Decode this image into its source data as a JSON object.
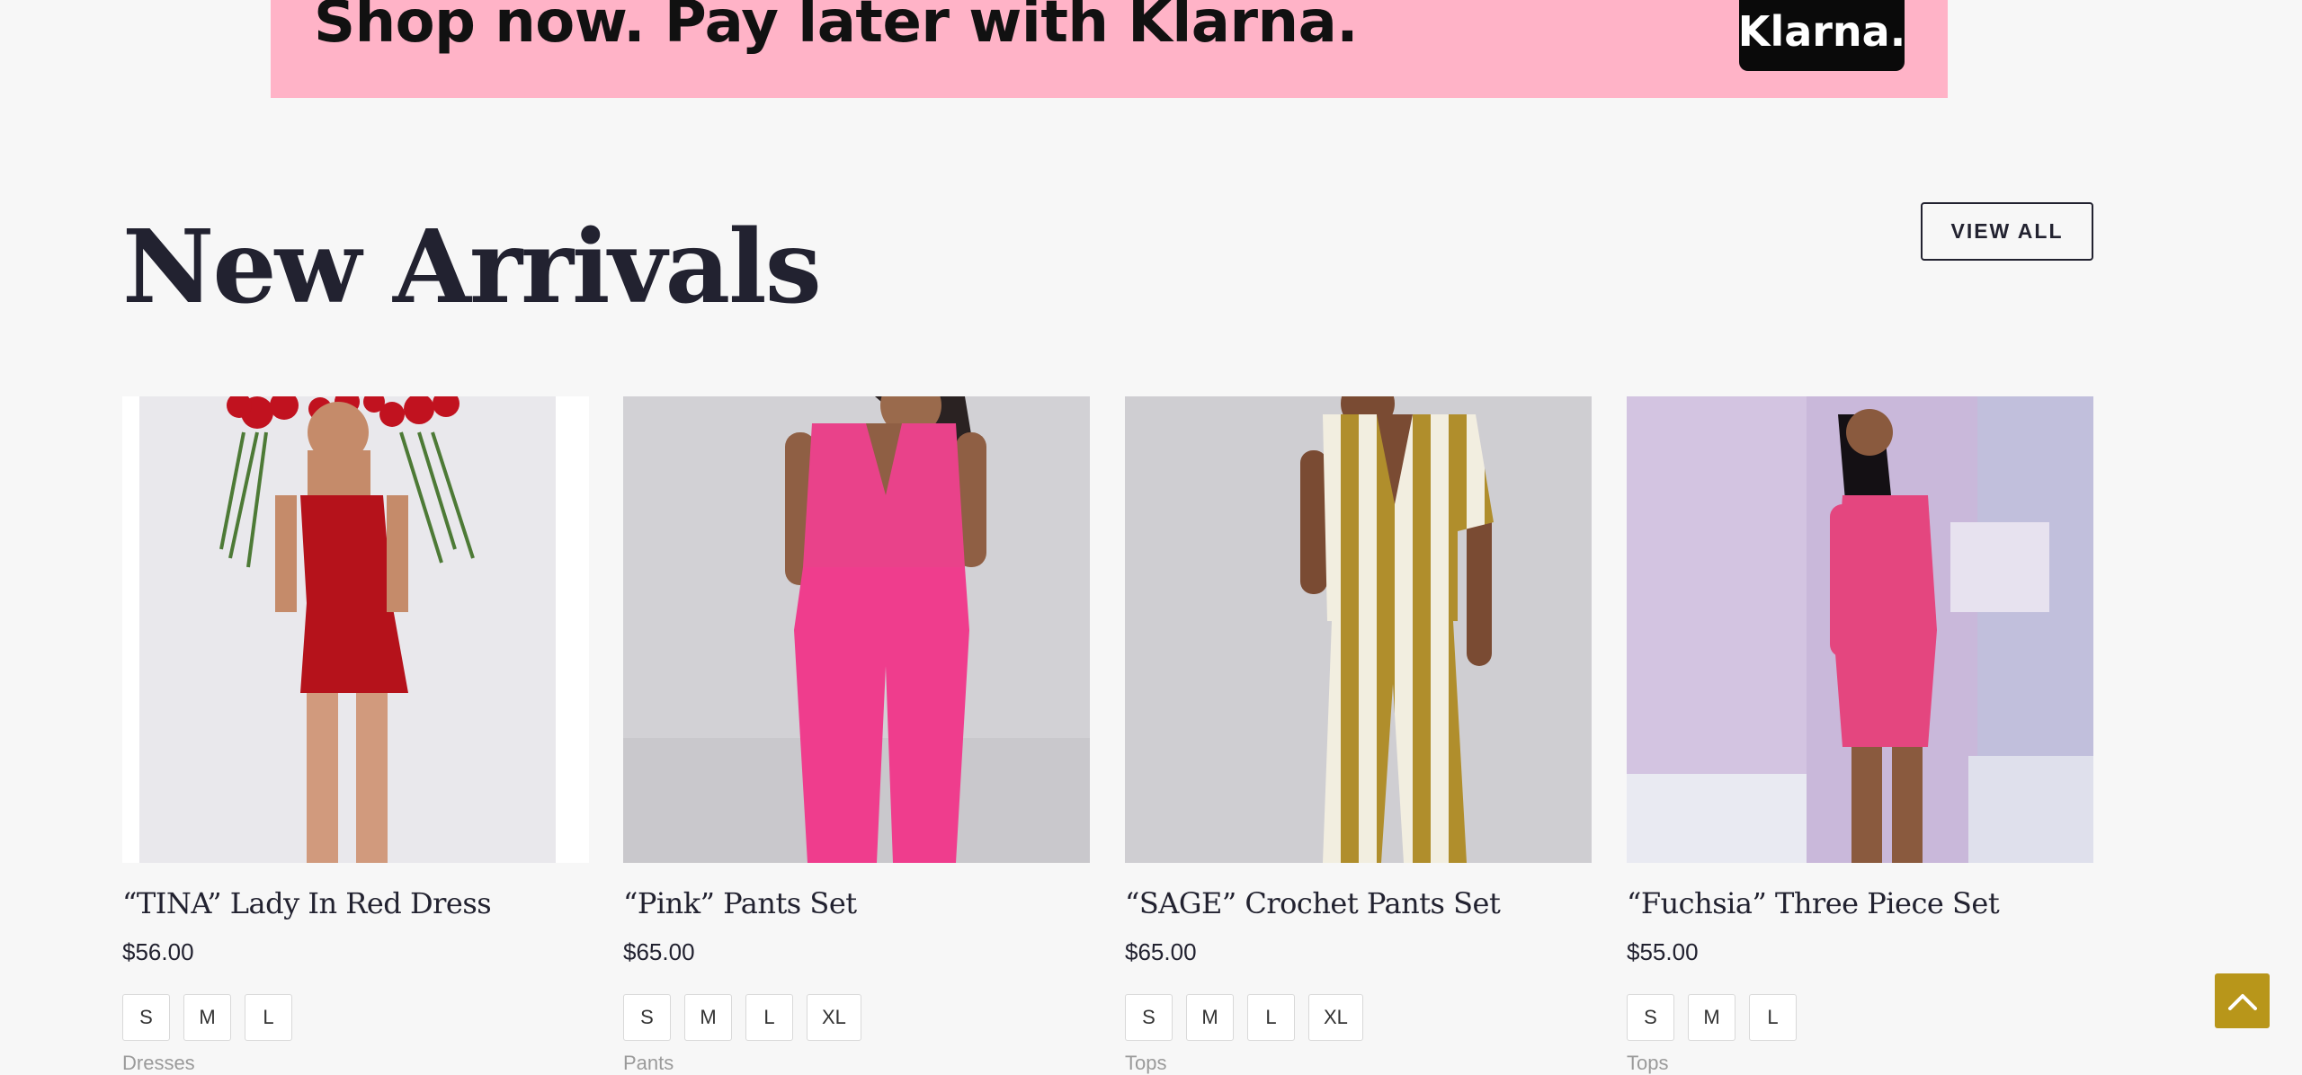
{
  "banner": {
    "text": "Shop now. Pay later with Klarna.",
    "badge": "Klarna.",
    "background": "#ffb3c7"
  },
  "section": {
    "title": "New Arrivals",
    "view_all_label": "VIEW ALL"
  },
  "products": [
    {
      "name": "“TINA” Lady In Red Dress",
      "price": "$56.00",
      "sizes": [
        "S",
        "M",
        "L"
      ],
      "category": "Dresses",
      "image": "model-in-red-fringe-dress-with-roses"
    },
    {
      "name": "“Pink” Pants Set",
      "price": "$65.00",
      "sizes": [
        "S",
        "M",
        "L",
        "XL"
      ],
      "category": "Pants",
      "image": "model-in-hot-pink-vest-and-pants"
    },
    {
      "name": "“SAGE” Crochet Pants Set",
      "price": "$65.00",
      "sizes": [
        "S",
        "M",
        "L",
        "XL"
      ],
      "category": "Tops",
      "image": "model-in-striped-crochet-set"
    },
    {
      "name": "“Fuchsia” Three Piece Set",
      "price": "$55.00",
      "sizes": [
        "S",
        "M",
        "L"
      ],
      "category": "Tops",
      "image": "model-in-fuchsia-set-at-event-wall"
    }
  ],
  "back_to_top": {
    "icon": "chevron-up-icon",
    "color": "#b8961a"
  },
  "colors": {
    "background": "#f7f7f7",
    "text": "#222230",
    "accent": "#b8961a"
  }
}
